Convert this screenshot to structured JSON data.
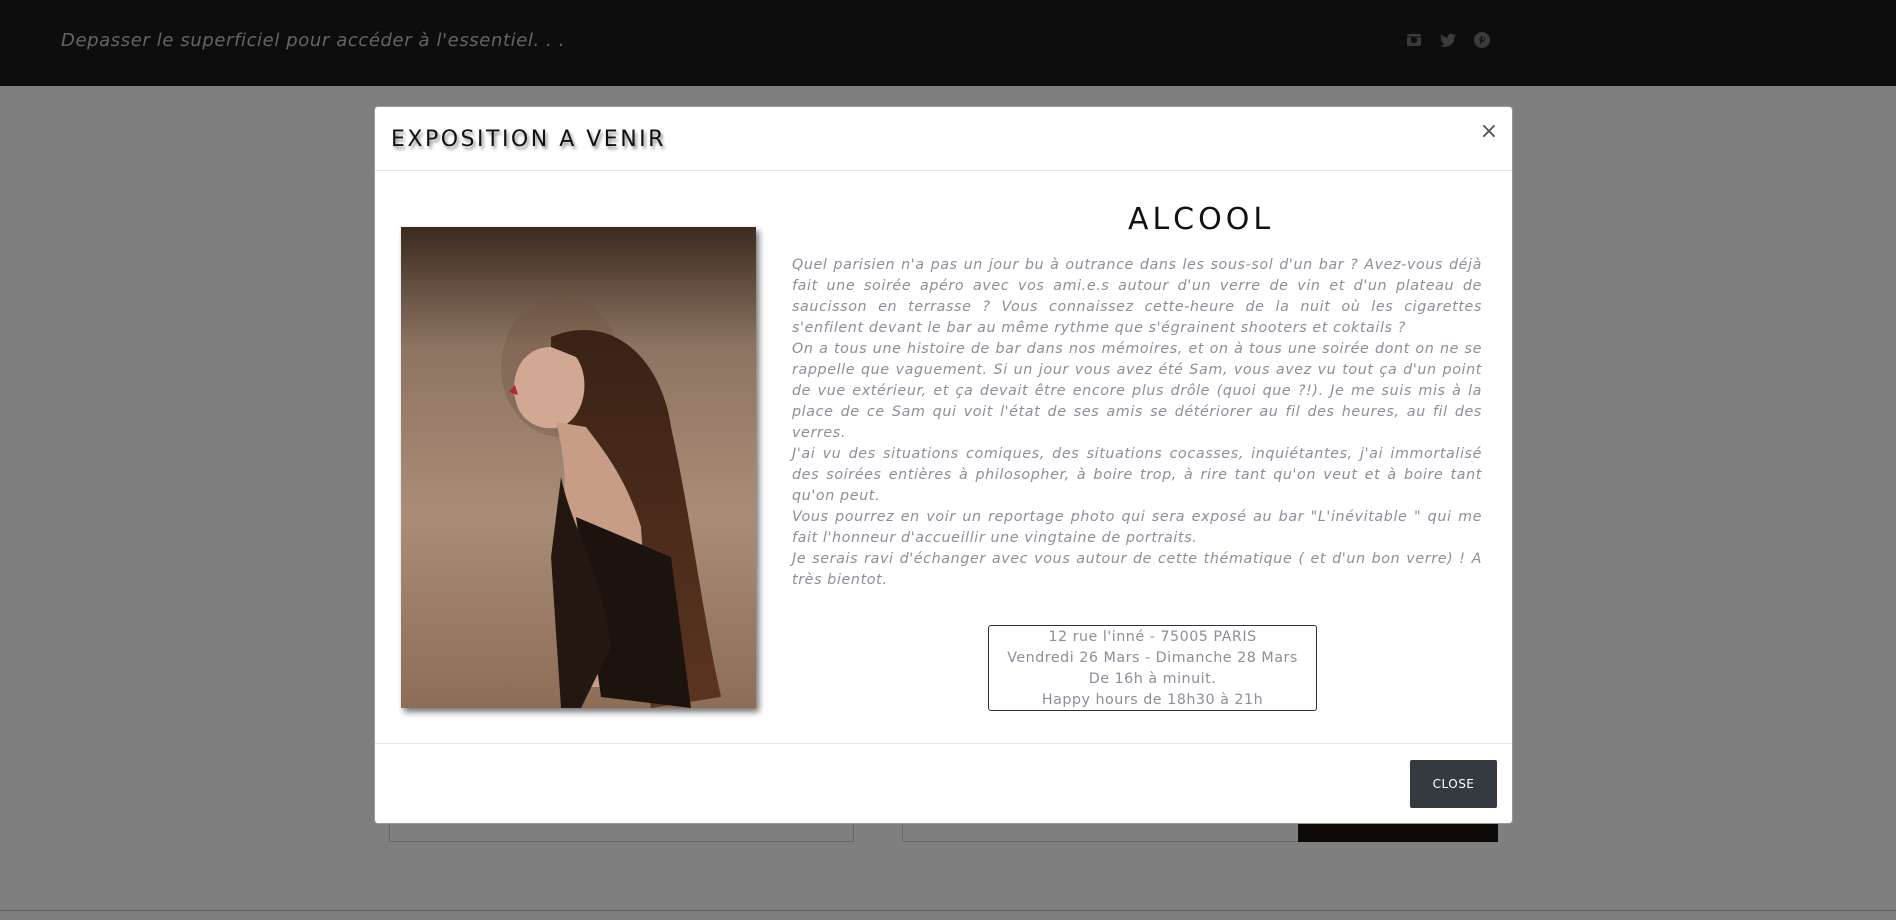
{
  "header": {
    "tagline": "Depasser le superficiel pour accéder à l'essentiel. . .",
    "social_icons": [
      "instagram-icon",
      "twitter-icon",
      "pinterest-icon"
    ]
  },
  "modal": {
    "title": "EXPOSITION A VENIR",
    "close_symbol": "×",
    "exhibition_title": "ALCOOL",
    "description": [
      "Quel parisien n'a pas un jour bu à outrance dans les sous-sol d'un bar ? Avez-vous déjà fait une soirée apéro avec vos ami.e.s autour d'un verre de vin et d'un plateau de saucisson en terrasse ? Vous connaissez cette-heure de la nuit où les cigarettes s'enfilent devant le bar au même rythme que s'égrainent shooters et coktails ?",
      "On a tous une histoire de bar dans nos mémoires, et on à tous une soirée dont on ne se rappelle que vaguement. Si un jour vous avez été Sam, vous avez vu tout ça d'un point de vue extérieur, et ça devait être encore plus drôle (quoi que ?!). Je me suis mis à la place de ce Sam qui voit l'état de ses amis se détériorer au fil des heures, au fil des verres.",
      "J'ai vu des situations comiques, des situations cocasses, inquiétantes, j'ai immortalisé des soirées entières à philosopher, à boire trop, à rire tant qu'on veut et à boire tant qu'on peut.",
      "Vous pourrez en voir un reportage photo qui sera exposé au bar \"L'inévitable \" qui me fait l'honneur d'accueillir une vingtaine de portraits.",
      "Je serais ravi d'échanger avec vous autour de cette thématique ( et d'un bon verre) ! A très bientot."
    ],
    "info": {
      "address": "12 rue l'inné - 75005 PARIS",
      "dates": "Vendredi 26 Mars - Dimanche 28 Mars",
      "hours": "De 16h à minuit.",
      "happy_hours": "Happy hours de 18h30 à 21h"
    },
    "close_button": "CLOSE"
  },
  "colors": {
    "header_bg": "#1a1a1a",
    "overlay": "rgba(0,0,0,0.5)",
    "text_muted": "#8a8f99",
    "button_bg": "#343a40"
  }
}
